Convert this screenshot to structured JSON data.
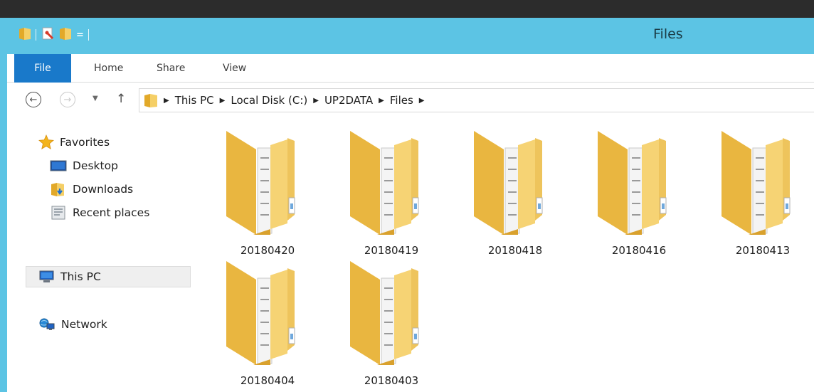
{
  "window": {
    "title": "Files"
  },
  "quick_access": {
    "customize_glyph": "="
  },
  "ribbon": {
    "tabs": [
      {
        "label": "File"
      },
      {
        "label": "Home"
      },
      {
        "label": "Share"
      },
      {
        "label": "View"
      }
    ]
  },
  "navigation": {
    "back_icon": "back-arrow-icon",
    "forward_icon": "forward-arrow-icon",
    "recent_icon": "chevron-down-icon",
    "up_icon": "up-arrow-icon"
  },
  "address": {
    "breadcrumbs": [
      "This PC",
      "Local Disk (C:)",
      "UP2DATA",
      "Files"
    ]
  },
  "nav_pane": {
    "favorites": {
      "label": "Favorites",
      "icon": "star-icon"
    },
    "favorites_items": [
      {
        "label": "Desktop",
        "icon": "desktop-icon"
      },
      {
        "label": "Downloads",
        "icon": "downloads-icon"
      },
      {
        "label": "Recent places",
        "icon": "recent-places-icon"
      }
    ],
    "this_pc": {
      "label": "This PC",
      "icon": "computer-icon",
      "selected": true
    },
    "network": {
      "label": "Network",
      "icon": "network-icon"
    }
  },
  "folders": [
    {
      "name": "20180420"
    },
    {
      "name": "20180419"
    },
    {
      "name": "20180418"
    },
    {
      "name": "20180416"
    },
    {
      "name": "20180413"
    },
    {
      "name": "20180404"
    },
    {
      "name": "20180403"
    }
  ],
  "colors": {
    "titlebar": "#5cc4e4",
    "file_tab": "#1979ca",
    "folder": "#f2c75c"
  }
}
